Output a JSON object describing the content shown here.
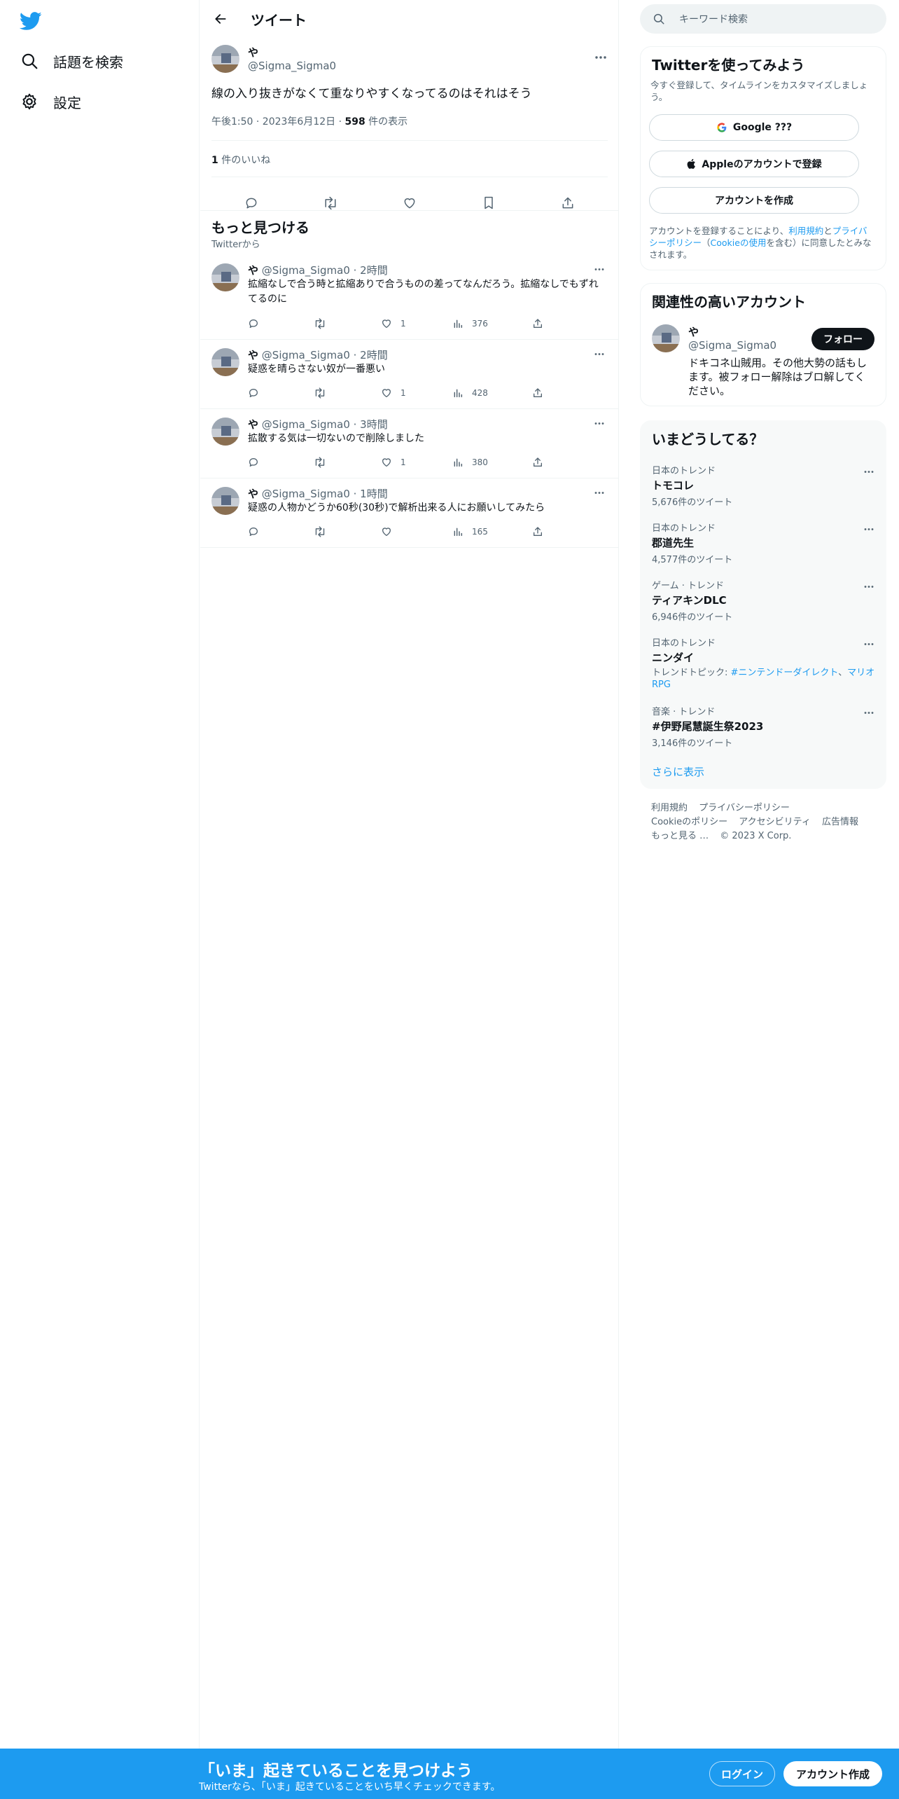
{
  "nav": {
    "logo": "twitter-bird-icon",
    "items": [
      {
        "label": "話題を検索",
        "icon": "search-icon"
      },
      {
        "label": "設定",
        "icon": "gear-icon"
      }
    ]
  },
  "header": {
    "title": "ツイート"
  },
  "tweet": {
    "name": "や",
    "handle": "@Sigma_Sigma0",
    "text": "線の入り抜きがなくて重なりやすくなってるのはそれはそう",
    "time": "午後1:50 · 2023年6月12日 · ",
    "views": "598",
    "views_label": " 件の表示",
    "likes": "1",
    "likes_label": " 件のいいね"
  },
  "more": {
    "title": "もっと見つける",
    "subtitle": "Twitterから"
  },
  "related": [
    {
      "name": "や",
      "handle": "@Sigma_Sigma0 · 2時間",
      "text": "拡縮なしで合う時と拡縮ありで合うものの差ってなんだろう。拡縮なしでもずれてるのに",
      "likes": "1",
      "views": "376"
    },
    {
      "name": "や",
      "handle": "@Sigma_Sigma0 · 2時間",
      "text": "疑惑を晴らさない奴が一番悪い",
      "likes": "1",
      "views": "428"
    },
    {
      "name": "や",
      "handle": "@Sigma_Sigma0 · 3時間",
      "text": "拡散する気は一切ないので削除しました",
      "likes": "1",
      "views": "380"
    },
    {
      "name": "や",
      "handle": "@Sigma_Sigma0 · 1時間",
      "text": "疑惑の人物かどうか60秒(30秒)で解析出来る人にお願いしてみたら",
      "likes": "",
      "views": "165"
    }
  ],
  "search": {
    "placeholder": "キーワード検索"
  },
  "signup": {
    "title": "Twitterを使ってみよう",
    "subtitle": "今すぐ登録して、タイムラインをカスタマイズしましょう。",
    "google": "Google ???",
    "apple": "Appleのアカウントで登録",
    "create": "アカウントを作成",
    "terms_pre": "アカウントを登録することにより、",
    "terms_link1": "利用規約",
    "terms_and": "と",
    "terms_link2": "プライバシーポリシー",
    "terms_paren_open": "（",
    "terms_link3": "Cookieの使用",
    "terms_post": "を含む）に同意したとみなされます。"
  },
  "relevant": {
    "title": "関連性の高いアカウント",
    "name": "や",
    "handle": "@Sigma_Sigma0",
    "follow": "フォロー",
    "bio": "ドキコネ山賊用。その他大勢の話もします。被フォロー解除はブロ解してください。"
  },
  "trends": {
    "title": "いまどうしてる？",
    "items": [
      {
        "context": "日本のトレンド",
        "name": "トモコレ",
        "count": "5,676件のツイート"
      },
      {
        "context": "日本のトレンド",
        "name": "郡道先生",
        "count": "4,577件のツイート"
      },
      {
        "context": "ゲーム · トレンド",
        "name": "ティアキンDLC",
        "count": "6,946件のツイート"
      },
      {
        "context": "日本のトレンド",
        "name": "ニンダイ",
        "topics_label": "トレンドトピック: ",
        "topic1": "#ニンテンドーダイレクト",
        "topic_sep": "、",
        "topic2": "マリオRPG"
      },
      {
        "context": "音楽 · トレンド",
        "name": "#伊野尾慧誕生祭2023",
        "count": "3,146件のツイート"
      }
    ],
    "show_more": "さらに表示"
  },
  "footer": {
    "links": [
      "利用規約",
      "プライバシーポリシー",
      "Cookieのポリシー",
      "アクセシビリティ",
      "広告情報",
      "もっと見る …",
      "© 2023 X Corp."
    ]
  },
  "bottom": {
    "title": "「いま」起きていることを見つけよう",
    "subtitle": "Twitterなら、「いま」起きていることをいち早くチェックできます。",
    "login": "ログイン",
    "signup": "アカウント作成"
  },
  "colors": {
    "accent": "#1d9bf0",
    "text": "#0f1419",
    "muted": "#536471",
    "border": "#eff3f4"
  }
}
